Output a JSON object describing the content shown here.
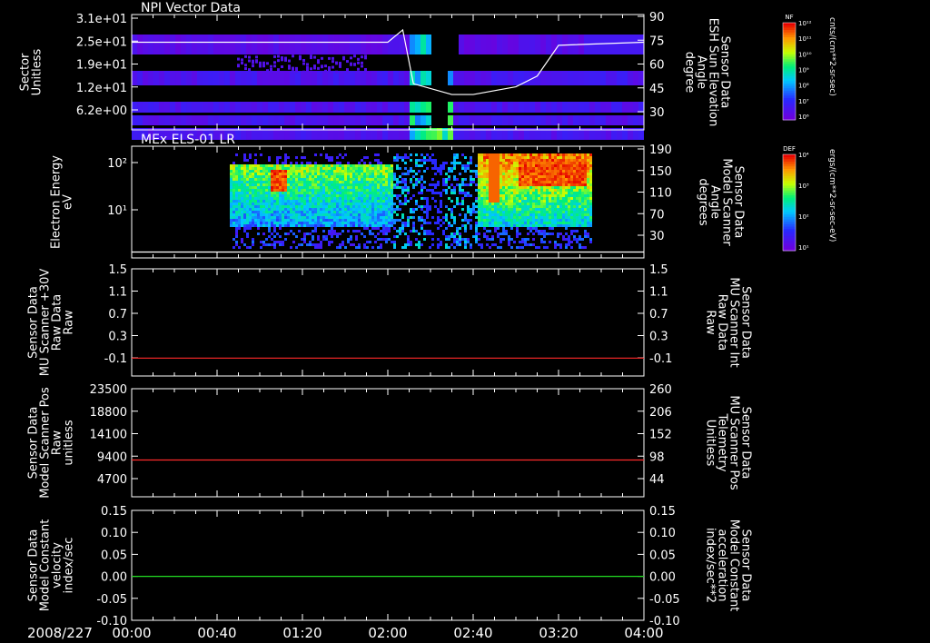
{
  "date_label": "2008/227",
  "time_ticks": [
    "00:00",
    "00:40",
    "01:20",
    "02:00",
    "02:40",
    "03:20",
    "04:00"
  ],
  "chart_data": [
    {
      "type": "heatmap",
      "title": "NPI Vector Data",
      "ylabel_left": [
        "Sector",
        "Unitless"
      ],
      "yticks_left": [
        "3.1e+01",
        "2.5e+01",
        "1.9e+01",
        "1.2e+01",
        "6.2e+00"
      ],
      "ylabel_right": [
        "Sensor Data",
        "ESH Sun Elevation",
        "Angle",
        "degree"
      ],
      "yticks_right": [
        "90",
        "75",
        "60",
        "45",
        "30"
      ],
      "yrange_right": [
        15,
        90
      ],
      "colorbar": {
        "label": "NF",
        "unit": "cnts/(cm**2-sr-sec)",
        "ticks": [
          "10¹²",
          "10¹¹",
          "10¹⁰",
          "10⁹",
          "10⁸",
          "10⁷",
          "10⁶"
        ]
      },
      "overlay_line": {
        "color": "#ffffff",
        "x": [
          "00:00",
          "02:00",
          "02:07",
          "02:12",
          "02:30",
          "02:40",
          "03:00",
          "03:10",
          "03:20",
          "04:00"
        ],
        "y": [
          72,
          72,
          80,
          45,
          38,
          38,
          43,
          50,
          70,
          72
        ]
      }
    },
    {
      "type": "heatmap",
      "title": "MEx ELS-01 LR",
      "ylabel_left": [
        "Electron Energy",
        "eV"
      ],
      "yticks_left": [
        "10²",
        "10¹"
      ],
      "ylabel_right": [
        "Sensor Data",
        "Model Scanner",
        "Angle",
        "degrees"
      ],
      "yticks_right": [
        "190",
        "150",
        "110",
        "70",
        "30"
      ],
      "yrange_right": [
        0,
        190
      ],
      "colorbar": {
        "label": "DEF",
        "unit": "ergs/(cm**2-sr-sec-eV)",
        "ticks": [
          "10⁴",
          "10³",
          "10²",
          "10¹"
        ]
      },
      "overlay_line": {
        "color": "#ffffff",
        "x": [
          "00:00",
          "04:00"
        ],
        "y": [
          10,
          10
        ]
      }
    },
    {
      "type": "line",
      "ylabel_left": [
        "Sensor Data",
        "MU Scanner +30V",
        "Raw Data",
        "Raw"
      ],
      "yticks_left": [
        "1.5",
        "1.1",
        "0.7",
        "0.3",
        "-0.1"
      ],
      "ylabel_right": [
        "Sensor Data",
        "MU Scanner Int",
        "Raw Data",
        "Raw"
      ],
      "yticks_right": [
        "1.5",
        "1.1",
        "0.7",
        "0.3",
        "-0.1"
      ],
      "ylim": [
        -0.3,
        1.5
      ],
      "series": [
        {
          "color": "#ff2a2a",
          "x": [
            "00:00",
            "04:00"
          ],
          "y": [
            0.0,
            0.0
          ]
        }
      ]
    },
    {
      "type": "line",
      "ylabel_left": [
        "Sensor Data",
        "Model Scanner Pos",
        "Raw",
        "unitless"
      ],
      "yticks_left": [
        "23500",
        "18800",
        "14100",
        "9400",
        "4700"
      ],
      "ylabel_right": [
        "Sensor Data",
        "MU Scanner Pos",
        "Telemetry",
        "Unitless"
      ],
      "yticks_right": [
        "260",
        "206",
        "152",
        "98",
        "44"
      ],
      "ylim": [
        0,
        23500
      ],
      "series": [
        {
          "color": "#ff2a2a",
          "x": [
            "00:00",
            "04:00"
          ],
          "y": [
            8000,
            8000
          ]
        }
      ]
    },
    {
      "type": "line",
      "ylabel_left": [
        "Sensor Data",
        "Model Constant",
        "velocity",
        "index/sec"
      ],
      "yticks_left": [
        "0.15",
        "0.10",
        "0.05",
        "0.00",
        "-0.05",
        "-0.10"
      ],
      "ylabel_right": [
        "Sensor Data",
        "Model Constant",
        "acceleration",
        "index/sec**2"
      ],
      "yticks_right": [
        "0.15",
        "0.10",
        "0.05",
        "0.00",
        "-0.05",
        "-0.10"
      ],
      "ylim": [
        -0.1,
        0.15
      ],
      "series": [
        {
          "color": "#22dd22",
          "x": [
            "00:00",
            "04:00"
          ],
          "y": [
            0.0,
            0.0
          ]
        }
      ]
    }
  ],
  "colors": {
    "right_label_panel3": "#ff2a2a",
    "right_label_panel4": "#ff2a2a",
    "right_label_panel5": "#22dd22"
  }
}
